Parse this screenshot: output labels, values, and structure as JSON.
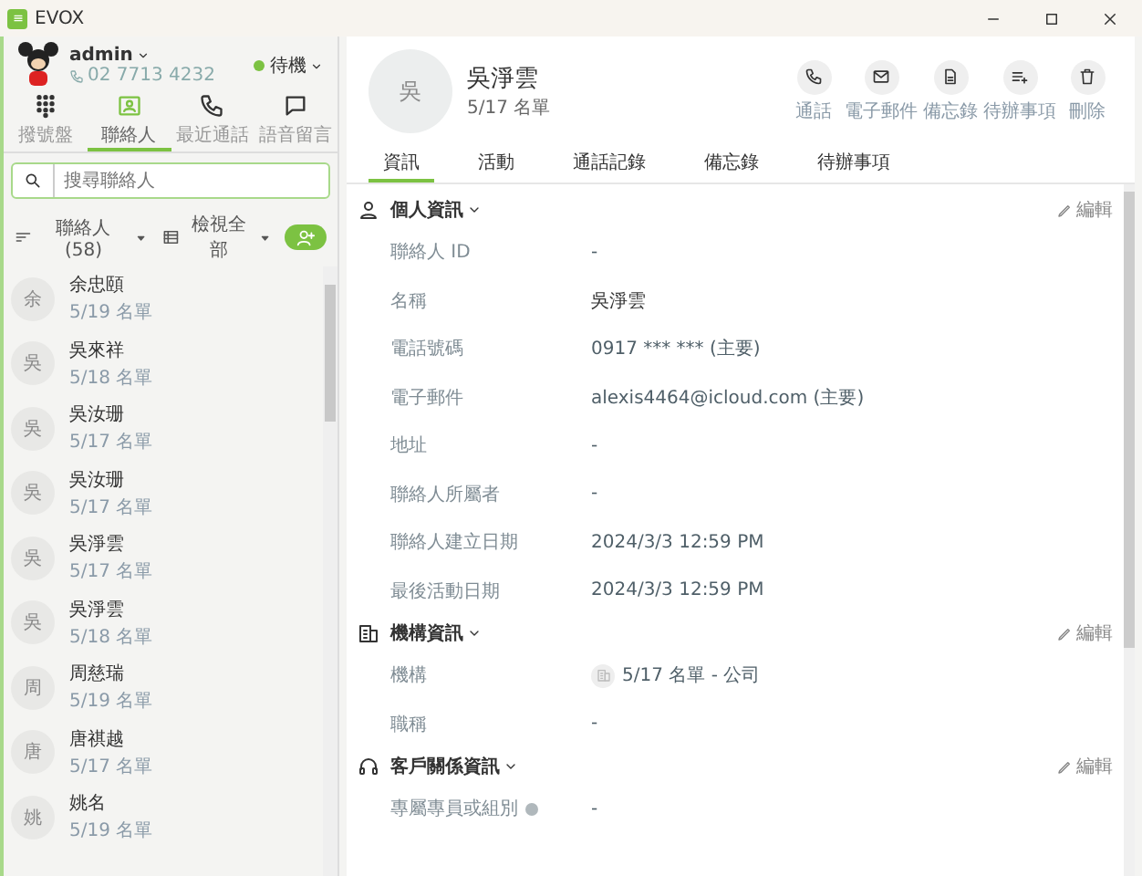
{
  "window": {
    "title": "EVOX"
  },
  "user": {
    "name": "admin",
    "phone": "02 7713 4232",
    "status": "待機"
  },
  "nav": [
    {
      "label": "撥號盤",
      "selected": false
    },
    {
      "label": "聯絡人",
      "selected": true
    },
    {
      "label": "最近通話",
      "selected": false
    },
    {
      "label": "語音留言",
      "selected": false
    }
  ],
  "search": {
    "placeholder": "搜尋聯絡人"
  },
  "filters": {
    "sort": "聯絡人 (58)",
    "view": "檢視全部"
  },
  "contacts": [
    {
      "avatar": "余",
      "name": "余忠頤",
      "list": "5/19 名單"
    },
    {
      "avatar": "吳",
      "name": "吳來祥",
      "list": "5/18 名單"
    },
    {
      "avatar": "吳",
      "name": "吳汝珊",
      "list": "5/17 名單"
    },
    {
      "avatar": "吳",
      "name": "吳汝珊",
      "list": "5/17 名單"
    },
    {
      "avatar": "吳",
      "name": "吳淨雲",
      "list": "5/17 名單"
    },
    {
      "avatar": "吳",
      "name": "吳淨雲",
      "list": "5/18 名單"
    },
    {
      "avatar": "周",
      "name": "周慈瑞",
      "list": "5/19 名單"
    },
    {
      "avatar": "唐",
      "name": "唐祺越",
      "list": "5/17 名單"
    },
    {
      "avatar": "姚",
      "name": "姚名",
      "list": "5/19 名單"
    }
  ],
  "detail": {
    "avatar": "吳",
    "name": "吳淨雲",
    "list": "5/17 名單",
    "actions": [
      {
        "label": "通話"
      },
      {
        "label": "電子郵件"
      },
      {
        "label": "備忘錄"
      },
      {
        "label": "待辦事項"
      },
      {
        "label": "刪除"
      }
    ],
    "tabs": [
      {
        "label": "資訊",
        "selected": true
      },
      {
        "label": "活動",
        "selected": false
      },
      {
        "label": "通話記錄",
        "selected": false
      },
      {
        "label": "備忘錄",
        "selected": false
      },
      {
        "label": "待辦事項",
        "selected": false
      }
    ],
    "sections": [
      {
        "title": "個人資訊",
        "edit": "編輯",
        "fields": [
          {
            "label": "聯絡人 ID",
            "value": "-",
            "kind": "plain"
          },
          {
            "label": "名稱",
            "value": "吳淨雲",
            "kind": "strong"
          },
          {
            "label": "電話號碼",
            "value": "0917 *** *** (主要)",
            "kind": "plain"
          },
          {
            "label": "電子郵件",
            "value": "alexis4464@icloud.com (主要)",
            "kind": "plain"
          },
          {
            "label": "地址",
            "value": "-",
            "kind": "plain"
          },
          {
            "label": "聯絡人所屬者",
            "value": "-",
            "kind": "plain"
          },
          {
            "label": "聯絡人建立日期",
            "value": "2024/3/3 12:59 PM",
            "kind": "plain"
          },
          {
            "label": "最後活動日期",
            "value": "2024/3/3 12:59 PM",
            "kind": "plain"
          }
        ]
      },
      {
        "title": "機構資訊",
        "edit": "編輯",
        "fields": [
          {
            "label": "機構",
            "value": "5/17 名單 - 公司",
            "kind": "org"
          },
          {
            "label": "職稱",
            "value": "-",
            "kind": "plain"
          }
        ]
      },
      {
        "title": "客戶關係資訊",
        "edit": "編輯",
        "fields": [
          {
            "label": "專屬專員或組別",
            "value": "-",
            "kind": "info"
          }
        ]
      }
    ]
  }
}
